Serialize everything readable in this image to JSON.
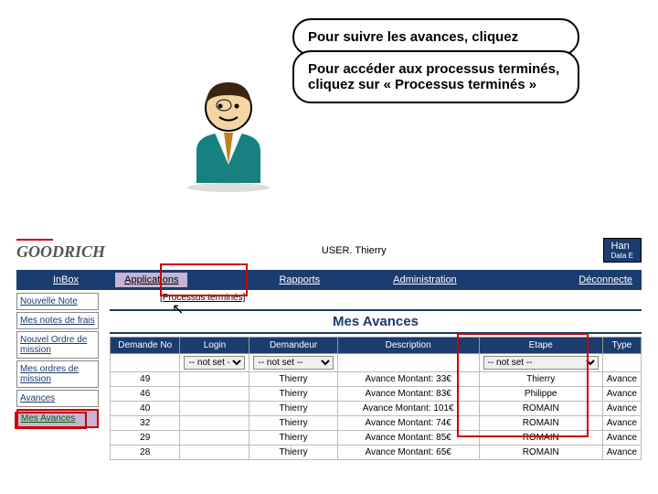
{
  "bubbles": {
    "b1": "Pour suivre les avances, cliquez",
    "b2": "Pour accéder aux processus terminés, cliquez sur « Processus terminés »"
  },
  "header": {
    "logo_left": "GOODRICH",
    "user": "USER. Thierry",
    "logo_right_1": "Han",
    "logo_right_2": "Data E"
  },
  "nav": {
    "inbox": "InBox",
    "applications": "Applications",
    "rapports": "Rapports",
    "administration": "Administration",
    "deconnecte": "Déconnecte"
  },
  "sidebar": {
    "s1": "Nouvelle Note",
    "s2": "Mes notes de frais",
    "s3": "Nouvel Ordre de mission",
    "s4": "Mes ordres de mission",
    "s5": "Avances",
    "s6": "Mes Avances"
  },
  "proc_term": "[Processus terminés]",
  "page_title": "Mes Avances",
  "columns": {
    "c1": "Demande No",
    "c2": "Login",
    "c3": "Demandeur",
    "c4": "Description",
    "c5": "Etape",
    "c6": "Type"
  },
  "filters": {
    "notset": "-- not set --"
  },
  "rows": [
    {
      "no": "49",
      "login": "",
      "dem": "Thierry",
      "desc": "Avance Montant: 33€",
      "etape": "Thierry",
      "type": "Avance"
    },
    {
      "no": "46",
      "login": "",
      "dem": "Thierry",
      "desc": "Avance Montant: 83€",
      "etape": "Philippe",
      "type": "Avance"
    },
    {
      "no": "40",
      "login": "",
      "dem": "Thierry",
      "desc": "Avance Montant: 101€",
      "etape": "ROMAIN",
      "type": "Avance"
    },
    {
      "no": "32",
      "login": "",
      "dem": "Thierry",
      "desc": "Avance Montant: 74€",
      "etape": "ROMAIN",
      "type": "Avance"
    },
    {
      "no": "29",
      "login": "",
      "dem": "Thierry",
      "desc": "Avance Montant: 85€",
      "etape": "ROMAIN",
      "type": "Avance"
    },
    {
      "no": "28",
      "login": "",
      "dem": "Thierry",
      "desc": "Avance Montant: 65€",
      "etape": "ROMAIN",
      "type": "Avance"
    }
  ]
}
